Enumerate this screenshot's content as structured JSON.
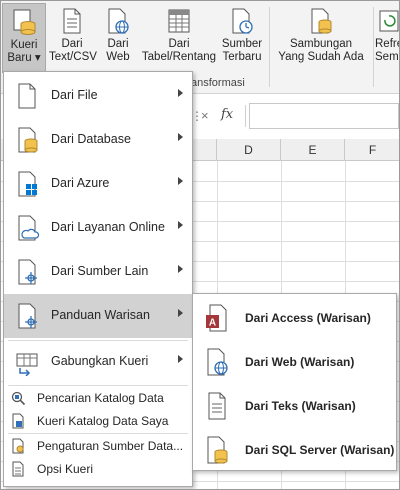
{
  "ribbon": {
    "buttons": [
      {
        "label1": "Kueri",
        "label2": "Baru ▾",
        "icon": "new-query-icon"
      },
      {
        "label1": "Dari",
        "label2": "Text/CSV",
        "icon": "text-file-icon"
      },
      {
        "label1": "Dari",
        "label2": "Web",
        "icon": "web-globe-icon"
      },
      {
        "label1": "Dari",
        "label2": "Tabel/Rentang",
        "icon": "table-icon"
      },
      {
        "label1": "Sumber",
        "label2": "Terbaru",
        "icon": "recent-sources-icon"
      },
      {
        "label1": "Sambungan",
        "label2": "Yang Sudah Ada",
        "icon": "existing-connections-icon"
      },
      {
        "label1": "Refre",
        "label2": "Semu",
        "icon": "refresh-all-icon"
      }
    ],
    "group_label": "ansformasi"
  },
  "formula_bar": {
    "fx": "fx",
    "cancel": "×",
    "dots": "⋮"
  },
  "columns": [
    "D",
    "E",
    "F"
  ],
  "menu": {
    "items": [
      {
        "label": "Dari File",
        "icon": "file-icon"
      },
      {
        "label": "Dari Database",
        "icon": "database-icon"
      },
      {
        "label": "Dari Azure",
        "icon": "azure-icon"
      },
      {
        "label": "Dari Layanan Online",
        "icon": "cloud-icon"
      },
      {
        "label": "Dari Sumber Lain",
        "icon": "other-sources-icon"
      },
      {
        "label": "Panduan Warisan",
        "icon": "legacy-wizard-icon"
      },
      {
        "label": "Gabungkan Kueri",
        "icon": "combine-queries-icon"
      }
    ],
    "small_items": [
      {
        "label": "Pencarian Katalog Data",
        "icon": "catalog-search-icon"
      },
      {
        "label": "Kueri Katalog Data Saya",
        "icon": "my-catalog-queries-icon"
      },
      {
        "label": "Pengaturan Sumber Data...",
        "icon": "data-source-settings-icon"
      },
      {
        "label": "Opsi Kueri",
        "icon": "query-options-icon"
      }
    ]
  },
  "submenu": {
    "items": [
      {
        "label": "Dari Access (Warisan)",
        "icon": "access-icon"
      },
      {
        "label": "Dari Web (Warisan)",
        "icon": "web-legacy-icon"
      },
      {
        "label": "Dari Teks (Warisan)",
        "icon": "text-legacy-icon"
      },
      {
        "label": "Dari SQL Server (Warisan)",
        "icon": "sql-server-icon"
      }
    ]
  },
  "colors": {
    "highlight": "#d2d2d2",
    "access_red": "#a4373a",
    "db_yellow": "#f2c14e",
    "azure_blue": "#0078d4",
    "accent_blue": "#2f6fb5"
  }
}
